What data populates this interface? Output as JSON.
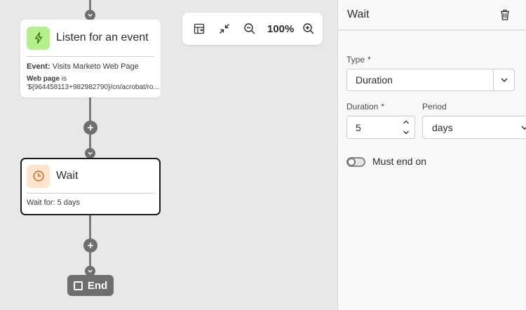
{
  "canvas": {
    "event_node": {
      "title": "Listen for an event",
      "event_label": "Event:",
      "event_value": "Visits Marketo Web Page",
      "condition_field": "Web page",
      "condition_op": "is",
      "condition_value": "'${964458113+982982790}/cn/acrobat/ro..."
    },
    "wait_node": {
      "title": "Wait",
      "detail": "Wait for: 5 days"
    },
    "end_node": {
      "label": "End"
    },
    "toolbar": {
      "zoom_level": "100%"
    }
  },
  "panel": {
    "title": "Wait",
    "type_label": "Type",
    "type_value": "Duration",
    "required_marker": "*",
    "duration_label": "Duration",
    "duration_value": "5",
    "period_label": "Period",
    "period_value": "days",
    "must_end_on_label": "Must end on",
    "must_end_on_enabled": false
  },
  "icons": {
    "event": "lightning-icon",
    "wait": "clock-icon",
    "delete": "trash-icon",
    "zoom_in": "zoom-in-icon",
    "zoom_out": "zoom-out-icon",
    "collapse": "collapse-icon",
    "auto_layout": "auto-layout-icon"
  },
  "colors": {
    "event_icon_bg": "#b6ef8c",
    "event_icon_fg": "#2f7d16",
    "wait_icon_bg": "#fde4cc",
    "wait_icon_fg": "#c95d11",
    "connector": "#6e6e6e",
    "selected_border": "#1a1a1a"
  }
}
